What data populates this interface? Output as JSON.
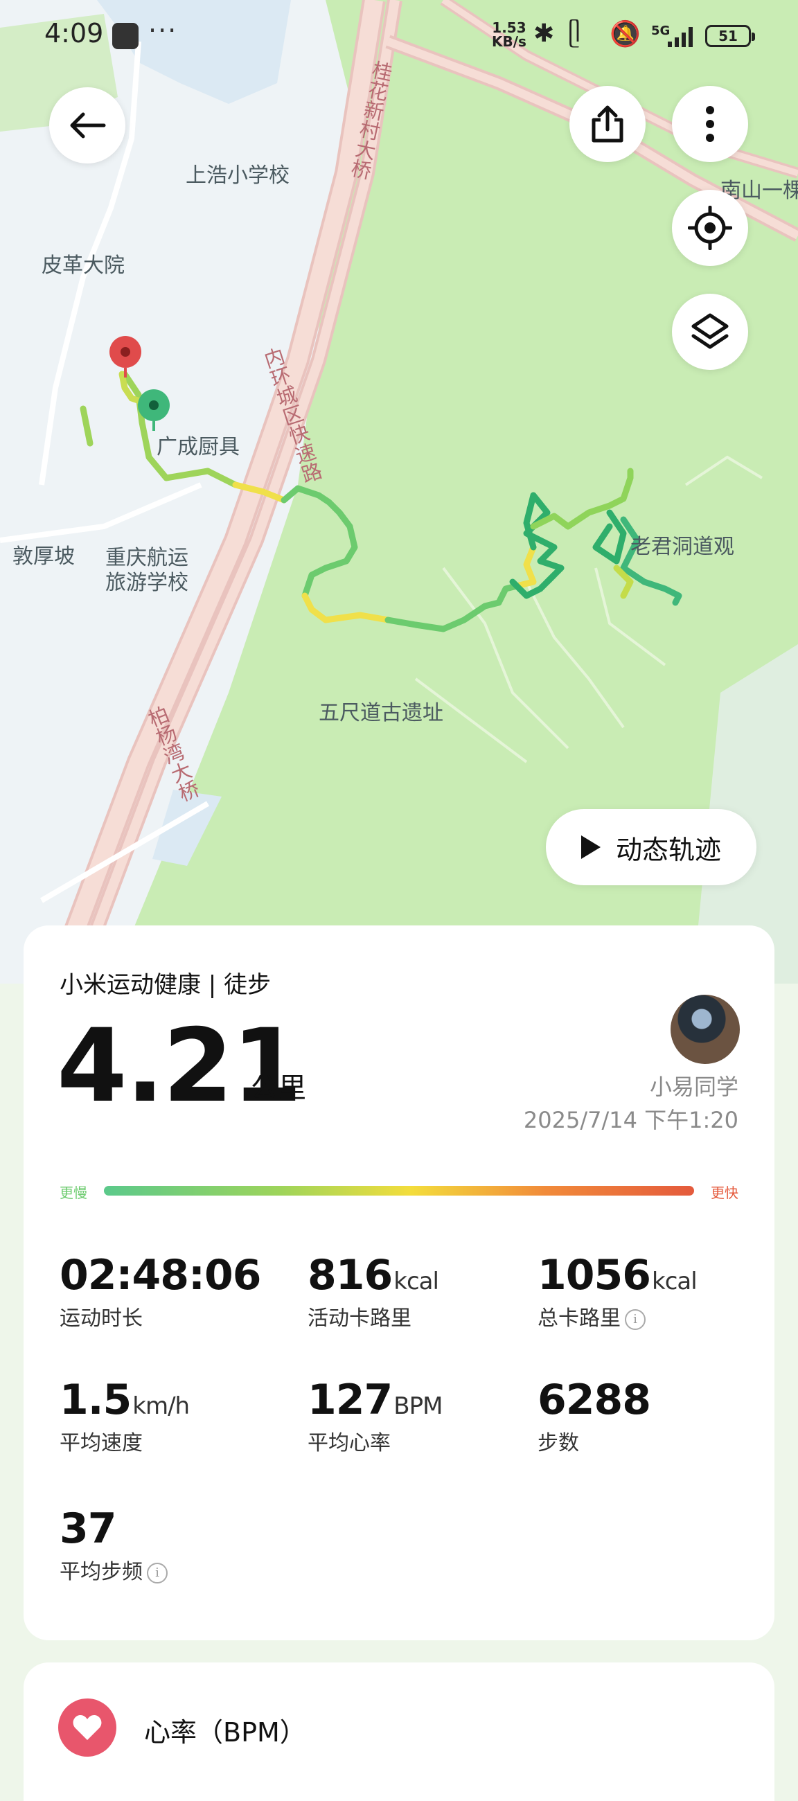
{
  "status_bar": {
    "time": "4:09",
    "net_speed_value": "1.53",
    "net_speed_unit": "KB/s",
    "battery": "51",
    "network": "5G"
  },
  "map": {
    "labels": {
      "school": "上浩小学校",
      "compound": "皮革大院",
      "shop": "广成厨具",
      "slope": "敦厚坡",
      "college": "重庆航运旅游学校",
      "temple": "老君洞道观",
      "ruins": "五尺道古遗址",
      "nanshan": "南山一棵"
    },
    "roads": {
      "bridge1": "桂花新村大桥",
      "expressway": "内环城区快速路",
      "bridge2": "柏杨湾大桥"
    },
    "dynamic_track_label": "动态轨迹"
  },
  "summary": {
    "title": "小米运动健康 | 徒步",
    "distance": "4.21",
    "distance_unit": "公里",
    "user_name": "小易同学",
    "date": "2025/7/14 下午1:20",
    "slower_label": "更慢",
    "faster_label": "更快"
  },
  "metrics": {
    "duration": {
      "value": "02:48:06",
      "unit": "",
      "label": "运动时长"
    },
    "active_cal": {
      "value": "816",
      "unit": "kcal",
      "label": "活动卡路里"
    },
    "total_cal": {
      "value": "1056",
      "unit": "kcal",
      "label": "总卡路里"
    },
    "avg_speed": {
      "value": "1.5",
      "unit": "km/h",
      "label": "平均速度"
    },
    "avg_hr": {
      "value": "127",
      "unit": "BPM",
      "label": "平均心率"
    },
    "steps": {
      "value": "6288",
      "unit": "",
      "label": "步数"
    },
    "cadence": {
      "value": "37",
      "unit": "",
      "label": "平均步频"
    }
  },
  "heart_rate_section": {
    "title": "心率（BPM）"
  },
  "icons": {
    "back": "arrow-left-icon",
    "share": "share-icon",
    "more": "more-vertical-icon",
    "locate": "locate-icon",
    "layers": "layers-icon",
    "play": "play-icon",
    "heart": "heart-icon",
    "info": "info-icon"
  },
  "colors": {
    "slow": "#5bc98b",
    "fast": "#e45a3c",
    "heart": "#e8566c",
    "start_pin": "#3fb77a",
    "end_pin": "#e04b4b"
  }
}
